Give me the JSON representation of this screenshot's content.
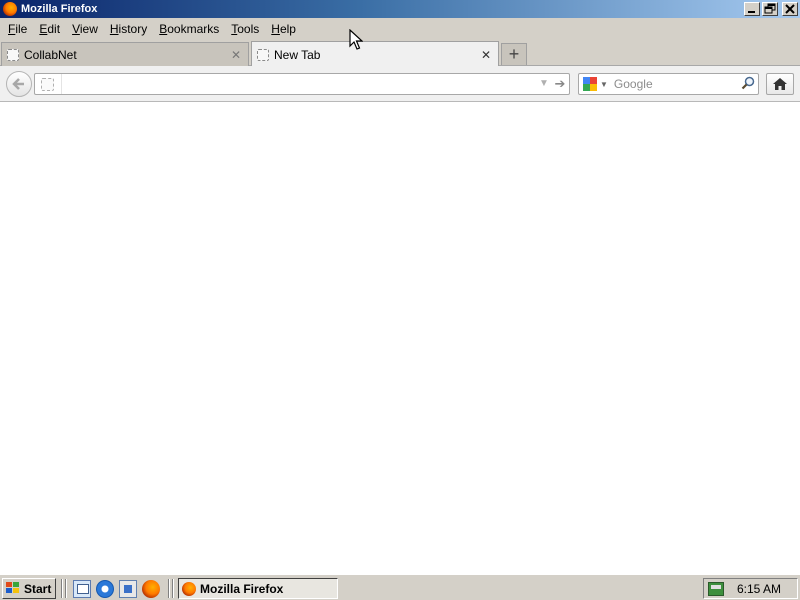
{
  "window": {
    "title": "Mozilla Firefox",
    "controls": [
      "minimize",
      "restore",
      "close"
    ]
  },
  "menu": {
    "items": [
      {
        "label": "File",
        "accel": "F",
        "rest": "ile"
      },
      {
        "label": "Edit",
        "accel": "E",
        "rest": "dit"
      },
      {
        "label": "View",
        "accel": "V",
        "rest": "iew"
      },
      {
        "label": "History",
        "accel": "H",
        "rest": "istory"
      },
      {
        "label": "Bookmarks",
        "accel": "B",
        "rest": "ookmarks"
      },
      {
        "label": "Tools",
        "accel": "T",
        "rest": "ools"
      },
      {
        "label": "Help",
        "accel": "H",
        "rest": "elp"
      }
    ]
  },
  "tabs": [
    {
      "label": "CollabNet",
      "active": false
    },
    {
      "label": "New Tab",
      "active": true
    }
  ],
  "toolbar": {
    "url_value": "",
    "search_placeholder": "Google",
    "search_value": ""
  },
  "taskbar": {
    "start_label": "Start",
    "task_button_label": "Mozilla Firefox",
    "quick_launch": [
      "show-desktop-icon",
      "internet-explorer-icon",
      "network-icon",
      "firefox-icon"
    ],
    "clock": "6:15 AM"
  },
  "icons": {
    "back": "back-arrow-icon",
    "home": "home-icon",
    "search": "magnifier-icon",
    "new_tab": "plus-icon",
    "tab_close": "close-icon"
  },
  "colors": {
    "titlebar_start": "#0a246a",
    "titlebar_end": "#a6caf0",
    "chrome": "#d4d0c8",
    "content_bg": "#ffffff"
  }
}
